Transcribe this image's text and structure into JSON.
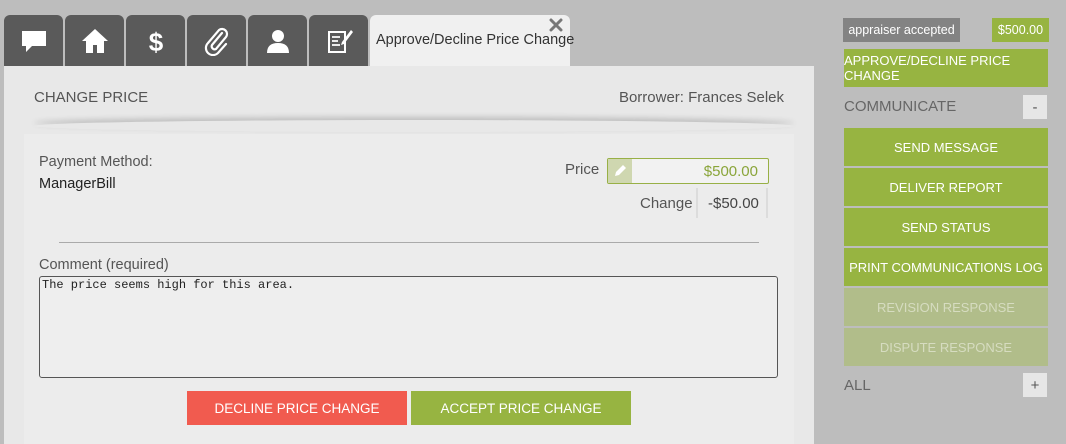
{
  "tabs": [
    {
      "icon": "chat-bubble-icon"
    },
    {
      "icon": "home-icon"
    },
    {
      "icon": "dollar-icon"
    },
    {
      "icon": "paperclip-icon"
    },
    {
      "icon": "user-icon"
    },
    {
      "icon": "edit-note-icon"
    }
  ],
  "active_tab": {
    "label": "Approve/Decline Price Change",
    "close_icon": "close-icon"
  },
  "panel": {
    "title": "CHANGE PRICE",
    "borrower": "Borrower: Frances Selek"
  },
  "form": {
    "payment_method_label": "Payment Method:",
    "payment_method_value": "ManagerBill",
    "price_label": "Price",
    "price_value": "$500.00",
    "change_label": "Change",
    "change_value": "-$50.00",
    "comment_label": "Comment (required)",
    "comment_value": "The price seems high for this area.",
    "decline_button": "DECLINE PRICE CHANGE",
    "accept_button": "ACCEPT PRICE CHANGE"
  },
  "sidebar": {
    "status_badge": "appraiser accepted",
    "price_badge": "$500.00",
    "primary_button": "APPROVE/DECLINE PRICE CHANGE",
    "communicate_label": "COMMUNICATE",
    "communicate_toggle": "-",
    "items": [
      {
        "label": "SEND MESSAGE",
        "enabled": true
      },
      {
        "label": "DELIVER REPORT",
        "enabled": true
      },
      {
        "label": "SEND STATUS",
        "enabled": true
      },
      {
        "label": "PRINT COMMUNICATIONS LOG",
        "enabled": true
      },
      {
        "label": "REVISION RESPONSE",
        "enabled": false
      },
      {
        "label": "DISPUTE RESPONSE",
        "enabled": false
      }
    ],
    "all_label": "ALL",
    "all_toggle": "+"
  },
  "colors": {
    "accent_green": "#97b441",
    "decline_red": "#f15b4f",
    "tab_dark": "#5a5a5a"
  }
}
